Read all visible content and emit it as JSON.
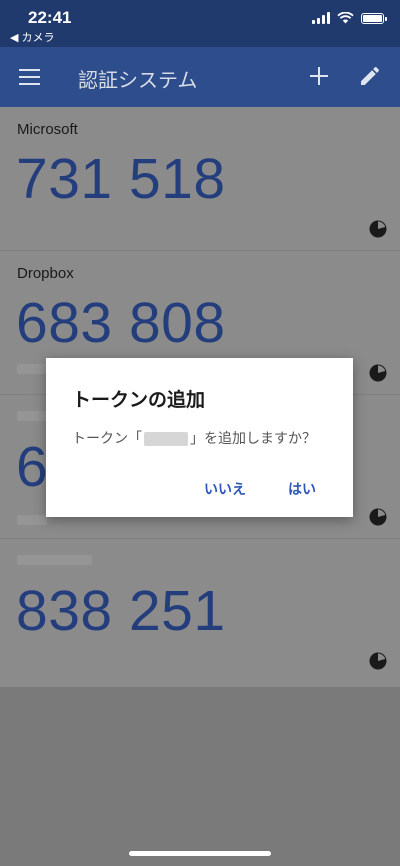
{
  "status_bar": {
    "time": "22:41",
    "back_app": "◀ カメラ",
    "icons": [
      "signal-icon",
      "wifi-icon",
      "battery-icon"
    ]
  },
  "app_bar": {
    "title": "認証システム",
    "icons": [
      "menu-icon",
      "add-icon",
      "edit-icon"
    ],
    "color": "#2e4d8c"
  },
  "accounts": [
    {
      "issuer": "Microsoft",
      "code": "731 518"
    },
    {
      "issuer": "Dropbox",
      "code": "683 808"
    },
    {
      "issuer": "",
      "code": "6"
    },
    {
      "issuer": "",
      "code": "838 251"
    }
  ],
  "dialog": {
    "title": "トークンの追加",
    "message_prefix": "トークン「",
    "message_suffix": "」を追加しますか？",
    "no_label": "いいえ",
    "yes_label": "はい",
    "accent": "#2c56b8"
  }
}
